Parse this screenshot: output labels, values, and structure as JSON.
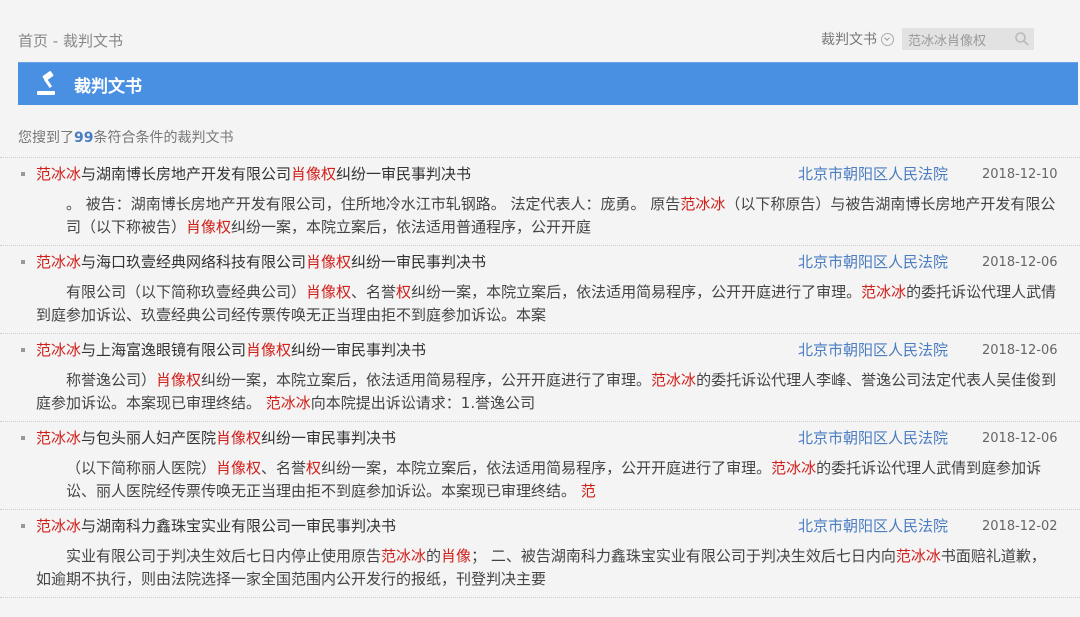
{
  "breadcrumb": {
    "home": "首页",
    "sep": " - ",
    "current": "裁判文书"
  },
  "search": {
    "type_label": "裁判文书",
    "query_value": "范冰冰肖像权"
  },
  "banner": {
    "title": "裁判文书"
  },
  "results": {
    "prefix": "您搜到了",
    "count": "99",
    "suffix": "条符合条件的裁判文书"
  },
  "colors": {
    "accent": "#4a90e2",
    "highlight": "#d0201c",
    "link": "#4a7cc2"
  },
  "items": [
    {
      "title": [
        [
          "范冰冰",
          true
        ],
        [
          "与湖南博长房地产开发有限公司",
          false
        ],
        [
          "肖像权",
          true
        ],
        [
          "纠纷一审民事判决书",
          false
        ]
      ],
      "court": "北京市朝阳区人民法院",
      "date": "2018-12-10",
      "snippet": [
        [
          "。 被告：湖南博长房地产开发有限公司，住所地冷水江市轧钢路。 法定代表人：庞勇。 原告",
          false
        ],
        [
          "范冰冰",
          true
        ],
        [
          "（以下称原告）与被告湖南博长房地产开发有限公司（以下称被告）",
          false
        ],
        [
          "肖像权",
          true
        ],
        [
          "纠纷一案，本院立案后，依法适用普通程序，公开开庭",
          false
        ]
      ]
    },
    {
      "title": [
        [
          "范冰冰",
          true
        ],
        [
          "与海口玖壹经典网络科技有限公司",
          false
        ],
        [
          "肖像权",
          true
        ],
        [
          "纠纷一审民事判决书",
          false
        ]
      ],
      "court": "北京市朝阳区人民法院",
      "date": "2018-12-06",
      "snippet": [
        [
          "有限公司（以下简称玖壹经典公司）",
          false
        ],
        [
          "肖像权",
          true
        ],
        [
          "、名誉",
          false
        ],
        [
          "权",
          true
        ],
        [
          "纠纷一案，本院立案后，依法适用简易程序，公开开庭进行了审理。",
          false
        ],
        [
          "范冰冰",
          true
        ],
        [
          "的委托诉讼代理人武倩到庭参加诉讼、玖壹经典公司经传票传唤无正当理由拒不到庭参加诉讼。本案",
          false
        ]
      ]
    },
    {
      "title": [
        [
          "范冰冰",
          true
        ],
        [
          "与上海富逸眼镜有限公司",
          false
        ],
        [
          "肖像权",
          true
        ],
        [
          "纠纷一审民事判决书",
          false
        ]
      ],
      "court": "北京市朝阳区人民法院",
      "date": "2018-12-06",
      "snippet": [
        [
          "称誉逸公司）",
          false
        ],
        [
          "肖像权",
          true
        ],
        [
          "纠纷一案，本院立案后，依法适用简易程序，公开开庭进行了审理。",
          false
        ],
        [
          "范冰冰",
          true
        ],
        [
          "的委托诉讼代理人李峰、誉逸公司法定代表人吴佳俊到庭参加诉讼。本案现已审理终结。 ",
          false
        ],
        [
          "范冰冰",
          true
        ],
        [
          "向本院提出诉讼请求：1.誉逸公司",
          false
        ]
      ]
    },
    {
      "title": [
        [
          "范冰冰",
          true
        ],
        [
          "与包头丽人妇产医院",
          false
        ],
        [
          "肖像权",
          true
        ],
        [
          "纠纷一审民事判决书",
          false
        ]
      ],
      "court": "北京市朝阳区人民法院",
      "date": "2018-12-06",
      "snippet": [
        [
          "（以下简称丽人医院）",
          false
        ],
        [
          "肖像权",
          true
        ],
        [
          "、名誉",
          false
        ],
        [
          "权",
          true
        ],
        [
          "纠纷一案，本院立案后，依法适用简易程序，公开开庭进行了审理。",
          false
        ],
        [
          "范冰冰",
          true
        ],
        [
          "的委托诉讼代理人武倩到庭参加诉讼、丽人医院经传票传唤无正当理由拒不到庭参加诉讼。本案现已审理终结。 ",
          false
        ],
        [
          "范",
          true
        ]
      ]
    },
    {
      "title": [
        [
          "范冰冰",
          true
        ],
        [
          "与湖南科力鑫珠宝实业有限公司一审民事判决书",
          false
        ]
      ],
      "court": "北京市朝阳区人民法院",
      "date": "2018-12-02",
      "snippet": [
        [
          "实业有限公司于判决生效后七日内停止使用原告",
          false
        ],
        [
          "范冰冰",
          true
        ],
        [
          "的",
          false
        ],
        [
          "肖像",
          true
        ],
        [
          "； 二、被告湖南科力鑫珠宝实业有限公司于判决生效后七日内向",
          false
        ],
        [
          "范冰冰",
          true
        ],
        [
          "书面赔礼道歉，如逾期不执行，则由法院选择一家全国范围内公开发行的报纸，刊登判决主要",
          false
        ]
      ]
    }
  ]
}
